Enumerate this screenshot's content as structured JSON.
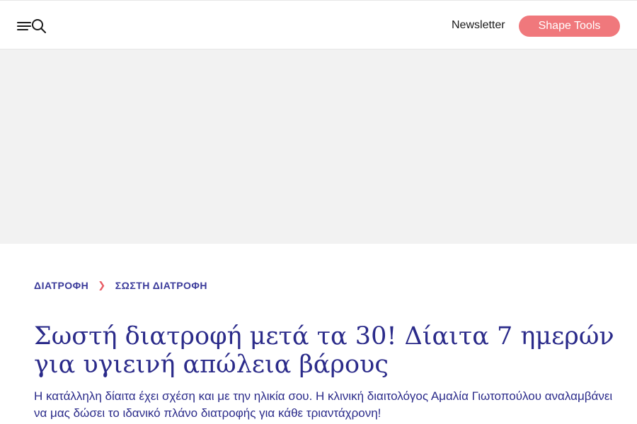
{
  "header": {
    "newsletter_label": "Newsletter",
    "tools_button_label": "Shape Tools",
    "accent_color": "#f0787c",
    "menu_icon": "hamburger-icon",
    "search_icon": "search-icon"
  },
  "breadcrumb": {
    "items": [
      "ΔΙΑΤΡΟΦΗ",
      "ΣΩΣΤΗ ΔΙΑΤΡΟΦΗ"
    ],
    "separator_icon": "chevron-right-icon"
  },
  "article": {
    "title": "Σωστή διατροφή μετά τα 30! Δίαιτα 7 ημερών για υγιεινή απώλεια βάρους",
    "subtitle": "Η κατάλληλη δίαιτα έχει σχέση και με την ηλικία σου. Η κλινική διαιτολόγος Αμαλία Γιωτοπούλου αναλαμβάνει να μας δώσει το ιδανικό πλάνο διατροφής για κάθε τριαντάχρονη!"
  }
}
